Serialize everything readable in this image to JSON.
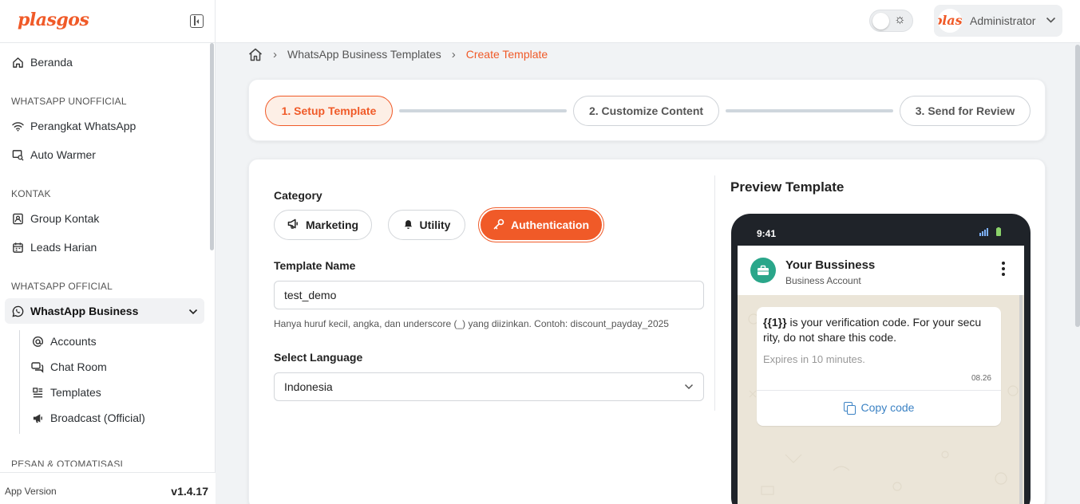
{
  "app": {
    "logo": "plasgos",
    "version_label": "App Version",
    "version": "v1.4.17"
  },
  "sidebar": {
    "home": "Beranda",
    "section_unofficial": "WHATSAPP UNOFFICIAL",
    "device": "Perangkat WhatsApp",
    "auto_warmer": "Auto Warmer",
    "section_contact": "KONTAK",
    "group_contact": "Group Kontak",
    "daily_leads": "Leads Harian",
    "section_official": "WHATSAPP OFFICIAL",
    "wa_business": "WhastApp Business",
    "sub": {
      "accounts": "Accounts",
      "chat_room": "Chat Room",
      "templates": "Templates",
      "broadcast": "Broadcast (Official)"
    },
    "section_automation": "PESAN & OTOMATISASI"
  },
  "header": {
    "user_name": "Administrator",
    "avatar_text": "plasgos"
  },
  "breadcrumb": {
    "item1": "WhatsApp Business Templates",
    "current": "Create Template"
  },
  "steps": {
    "step1": "1.  Setup Template",
    "step2": "2.  Customize Content",
    "step3": "3.  Send for Review"
  },
  "form": {
    "category_label": "Category",
    "categories": {
      "marketing": "Marketing",
      "utility": "Utility",
      "authentication": "Authentication"
    },
    "selected_category": "Authentication",
    "template_name_label": "Template Name",
    "template_name_value": "test_demo",
    "template_name_hint": "Hanya huruf kecil, angka, dan underscore (_) yang diizinkan. Contoh: discount_payday_2025",
    "language_label": "Select Language",
    "language_value": "Indonesia"
  },
  "preview": {
    "title": "Preview Template",
    "phone_time": "9:41",
    "business_name": "Your Bussiness",
    "business_sub": "Business Account",
    "message_var": "{{1}}",
    "message_rest": " is your verification code. For your secu rity, do not share this code.",
    "expires": "Expires in 10 minutes.",
    "msg_time": "08.26",
    "copy_label": "Copy code"
  },
  "colors": {
    "accent": "#f05a28",
    "link": "#3b82c4",
    "chat_bg": "#ebe5d8"
  }
}
